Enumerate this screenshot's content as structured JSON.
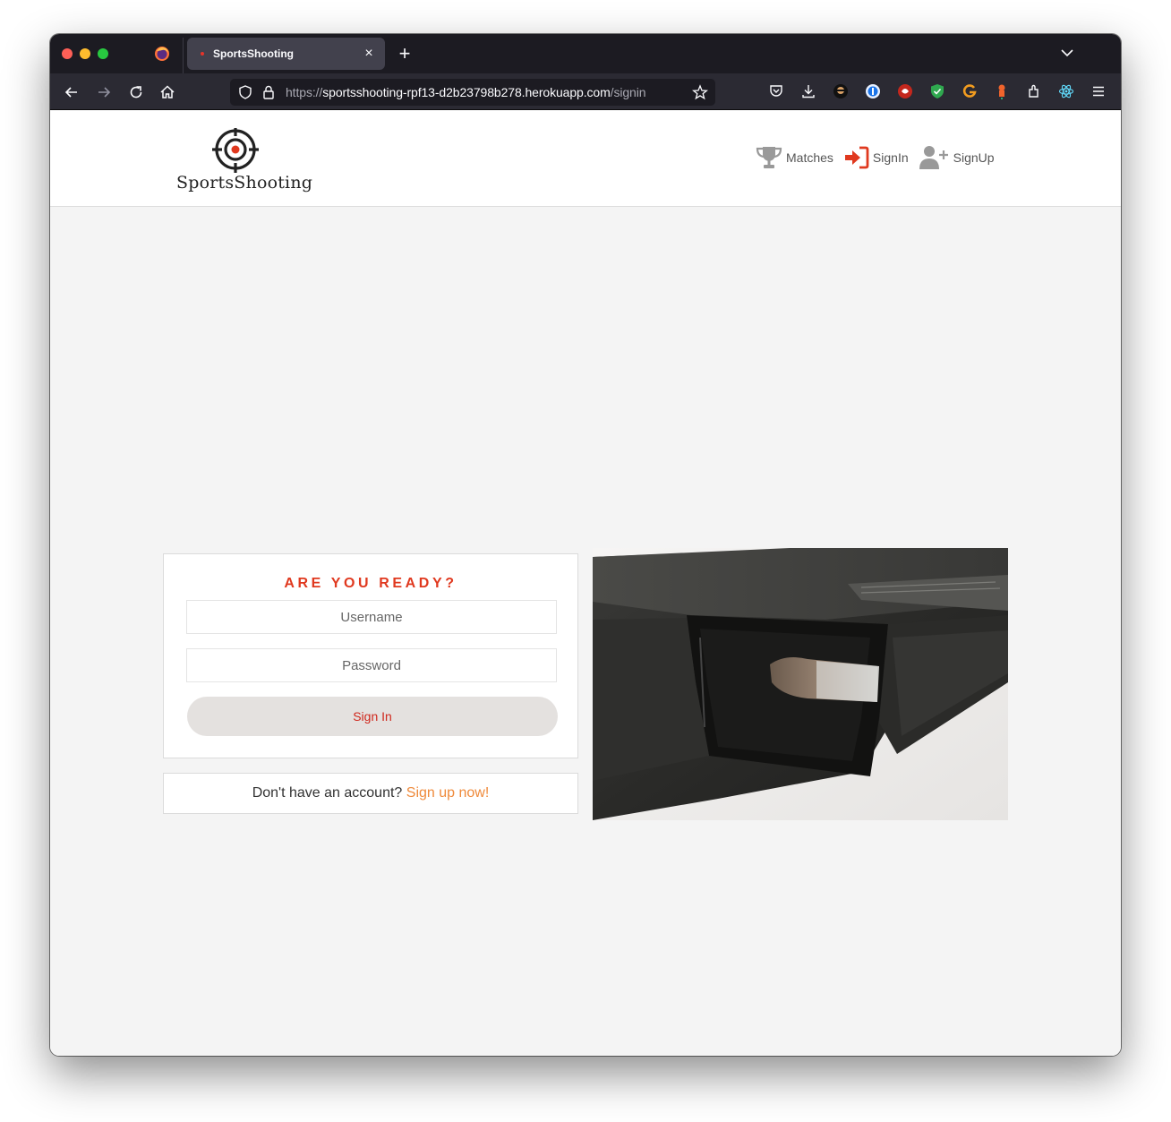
{
  "browser": {
    "tab_title": "SportsShooting",
    "url_prefix": "https://",
    "url_host": "sportsshooting-rpf13-d2b23798b278.herokuapp.com",
    "url_path": "/signin"
  },
  "site": {
    "brand_name": "SportsShooting",
    "nav": {
      "matches": "Matches",
      "signin": "SignIn",
      "signup": "SignUp"
    }
  },
  "signin": {
    "heading": "ARE YOU READY?",
    "username_placeholder": "Username",
    "password_placeholder": "Password",
    "submit_label": "Sign In"
  },
  "signup_prompt": {
    "text": "Don't have an account?",
    "link": "Sign up now!"
  },
  "colors": {
    "accent_red": "#e0391f",
    "link_orange": "#ef8a3b",
    "button_bg": "#e4e1df"
  },
  "icons": [
    "firefox-icon",
    "back-icon",
    "forward-icon",
    "reload-icon",
    "home-icon",
    "shield-icon",
    "lock-icon",
    "bookmark-star-icon",
    "pocket-icon",
    "download-icon",
    "extensions-icon",
    "menu-icon",
    "trophy-icon",
    "signin-icon",
    "add-user-icon",
    "target-logo-icon"
  ]
}
